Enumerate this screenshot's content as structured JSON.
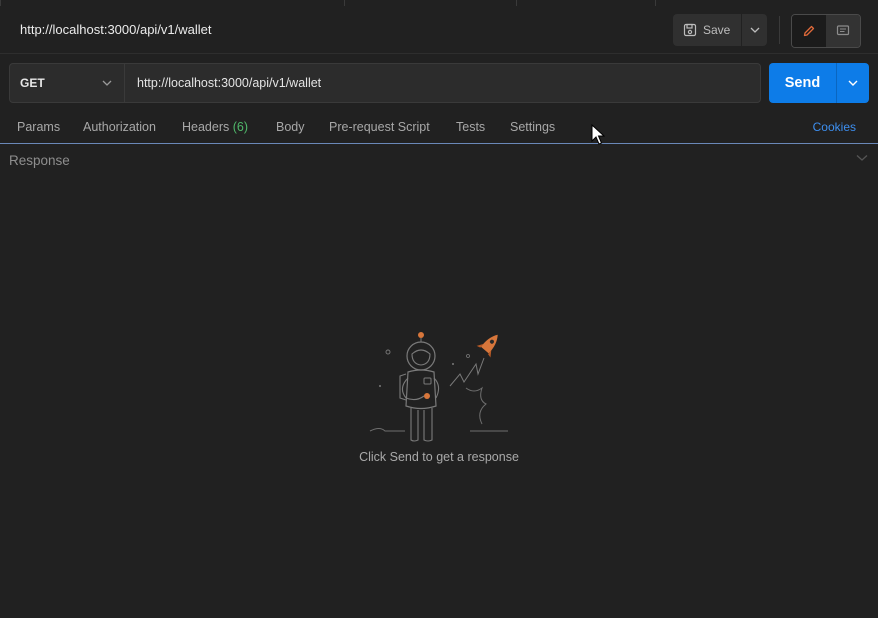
{
  "request": {
    "title": "http://localhost:3000/api/v1/wallet",
    "method": "GET",
    "url": "http://localhost:3000/api/v1/wallet"
  },
  "toolbar": {
    "save_label": "Save",
    "save_icon": "floppy-disk-icon",
    "edit_icon": "pencil-icon",
    "comments_icon": "comment-icon"
  },
  "send": {
    "label": "Send",
    "color": "#0d7ce8"
  },
  "tabs": {
    "params": "Params",
    "authorization": "Authorization",
    "headers": "Headers",
    "headers_count": "(6)",
    "body": "Body",
    "prerequest": "Pre-request Script",
    "tests": "Tests",
    "settings": "Settings",
    "cookies": "Cookies"
  },
  "response": {
    "label": "Response",
    "empty_message": "Click Send to get a response",
    "illustration": "astronaut-rocket-illustration"
  },
  "colors": {
    "background": "#212121",
    "accent": "#3d8ff0",
    "count_green": "#4fb86a",
    "pencil_orange": "#e06a3a"
  }
}
